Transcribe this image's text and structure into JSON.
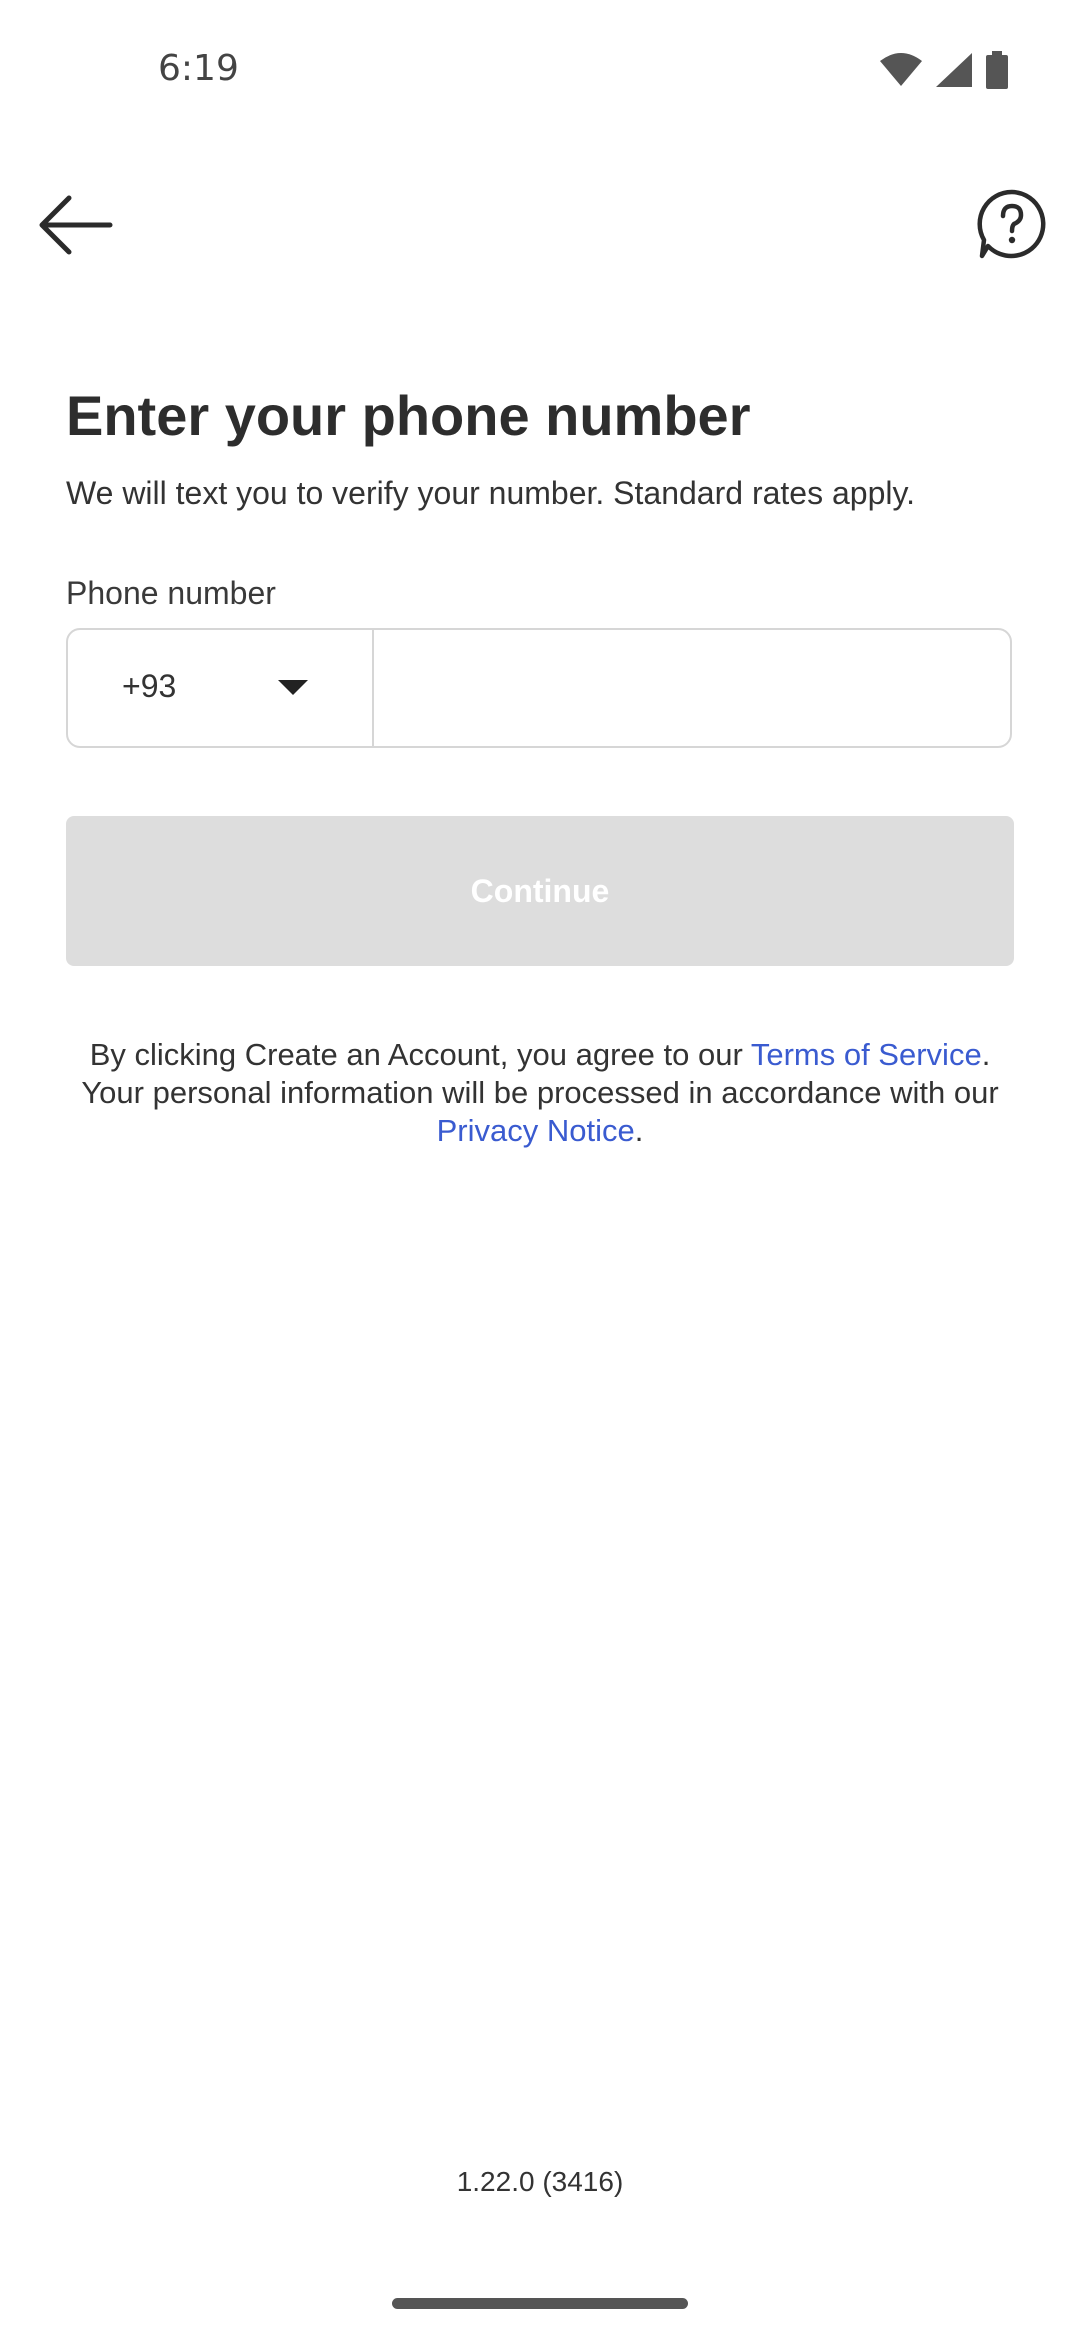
{
  "status_bar": {
    "time": "6:19",
    "icons": [
      "wifi-icon",
      "signal-icon",
      "battery-icon"
    ]
  },
  "appbar": {
    "back_icon": "arrow-left-icon",
    "help_icon": "question-circle-icon"
  },
  "main": {
    "title": "Enter your phone number",
    "subtitle": "We will text you to verify your number. Standard rates apply.",
    "phone_label": "Phone number",
    "country_code": "+93",
    "phone_value": "",
    "phone_placeholder": "",
    "continue_label": "Continue",
    "legal": {
      "part1": "By clicking Create an Account, you agree to our ",
      "terms_link": "Terms of Service",
      "part2": ". Your personal information will be processed in accordance with our ",
      "privacy_link": "Privacy Notice",
      "part3": "."
    }
  },
  "footer": {
    "version": "1.22.0 (3416)"
  },
  "colors": {
    "link": "#3a5bd0",
    "button_disabled": "#dddddd",
    "text": "#2b2b2b",
    "border": "#d6d6d6"
  }
}
